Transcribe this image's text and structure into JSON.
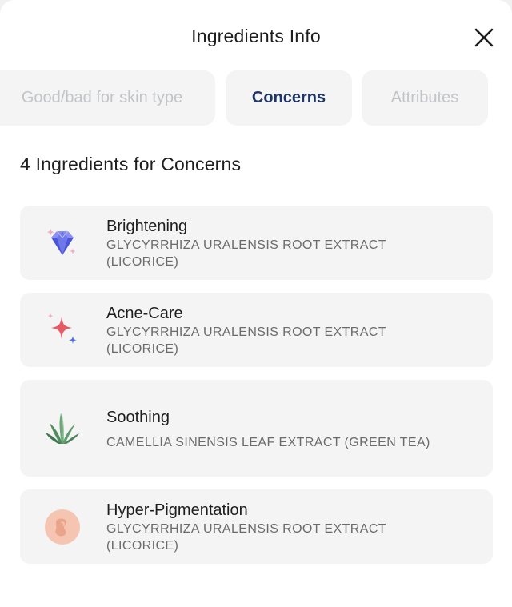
{
  "header": {
    "title": "Ingredients Info"
  },
  "tabs": [
    {
      "label": "Good/bad for skin type",
      "active": false
    },
    {
      "label": "Concerns",
      "active": true
    },
    {
      "label": "Attributes",
      "active": false
    }
  ],
  "section": {
    "title": "4 Ingredients for Concerns"
  },
  "concerns": [
    {
      "title": "Brightening",
      "ingredients": "GLYCYRRHIZA URALENSIS ROOT EXTRACT (LICORICE)",
      "icon": "diamond-icon"
    },
    {
      "title": "Acne-Care",
      "ingredients": "GLYCYRRHIZA URALENSIS ROOT EXTRACT (LICORICE)",
      "icon": "sparkle-icon"
    },
    {
      "title": "Soothing",
      "ingredients": "CAMELLIA SINENSIS LEAF EXTRACT (GREEN TEA)",
      "icon": "aloe-icon"
    },
    {
      "title": "Hyper-Pigmentation",
      "ingredients": "GLYCYRRHIZA URALENSIS ROOT EXTRACT (LICORICE)",
      "icon": "skin-spot-icon"
    }
  ],
  "colors": {
    "active_tab_text": "#1f3566",
    "inactive_tab_text": "#c2c4c8",
    "card_background": "#f4f4f5"
  }
}
